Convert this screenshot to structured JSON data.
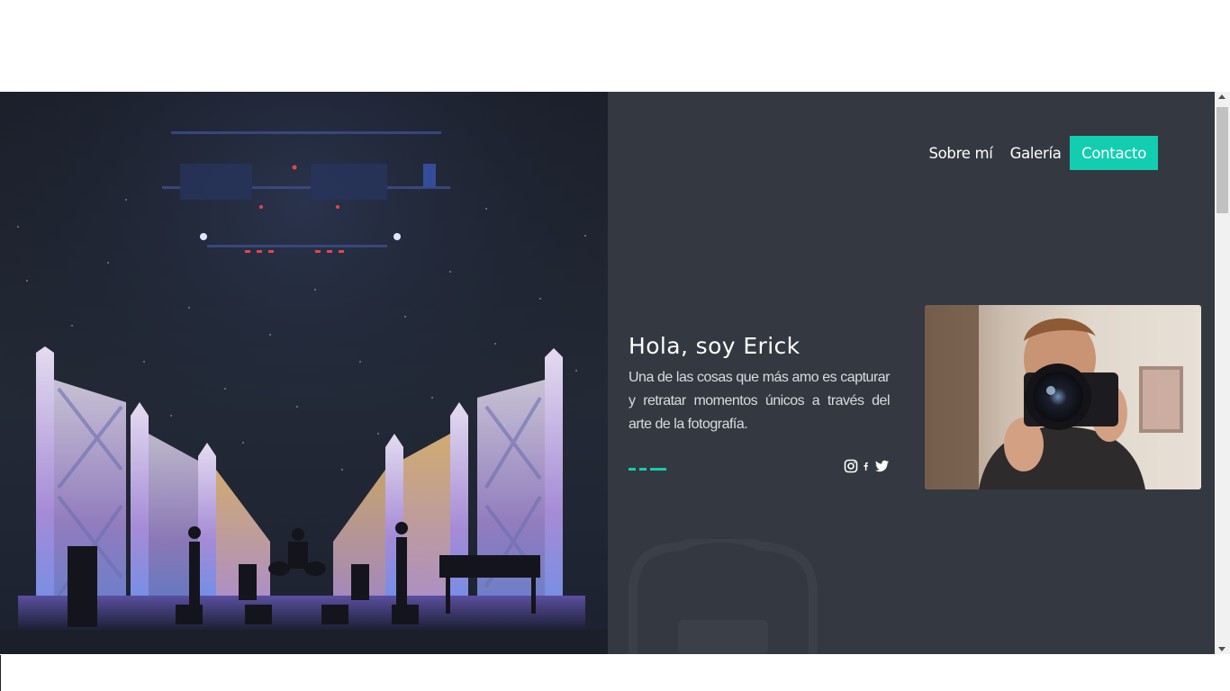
{
  "nav": {
    "items": [
      {
        "label": "Sobre mí"
      },
      {
        "label": "Galería"
      }
    ],
    "cta_label": "Contacto"
  },
  "intro": {
    "title": "Hola, soy Erick",
    "text": "Una de las cosas que más amo es capturar y retratar momentos únicos a través del arte de la fotografía."
  },
  "socials": [
    {
      "icon": "instagram-icon"
    },
    {
      "icon": "facebook-icon"
    },
    {
      "icon": "twitter-icon"
    }
  ],
  "colors": {
    "accent": "#13cdb0",
    "panel_background": "#343841",
    "text": "#ffffff"
  }
}
